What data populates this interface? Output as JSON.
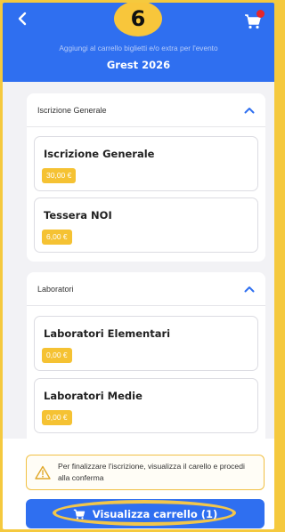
{
  "colors": {
    "primary": "#2f6ff0",
    "accent": "#f5c233",
    "frame": "#f5c93e",
    "alert_dot": "#e5262a"
  },
  "header": {
    "step_number": "6",
    "subtitle": "Aggiungi al carrello biglietti e/o extra per l'evento",
    "event_title": "Grest 2026",
    "back_icon": "chevron-left-icon",
    "cart_icon": "cart-icon"
  },
  "sections": [
    {
      "title": "Iscrizione Generale",
      "items": [
        {
          "name": "Iscrizione Generale",
          "price": "30,00 €"
        },
        {
          "name": "Tessera NOI",
          "price": "6,00 €"
        }
      ]
    },
    {
      "title": "Laboratori",
      "items": [
        {
          "name": "Laboratori Elementari",
          "price": "0,00 €"
        },
        {
          "name": "Laboratori Medie",
          "price": "0,00 €"
        }
      ]
    }
  ],
  "footer": {
    "notice": "Per finalizzare l'iscrizione, visualizza il carello e procedi alla conferma",
    "button_label": "Visualizza carrello (1)"
  }
}
